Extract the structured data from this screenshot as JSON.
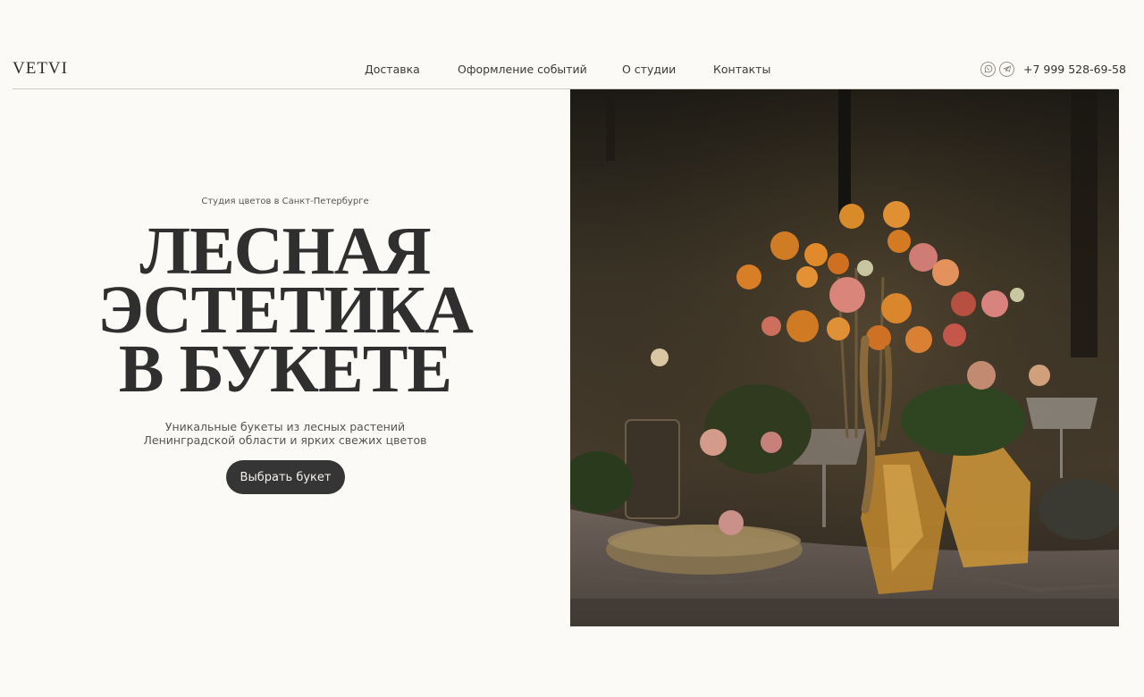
{
  "header": {
    "logo": "VETVI",
    "nav": [
      "Доставка",
      "Оформление событий",
      "О студии",
      "Контакты"
    ],
    "phone": "+7 999 528-69-58",
    "icons": [
      "whatsapp-icon",
      "telegram-icon"
    ]
  },
  "hero": {
    "subtitle": "Студия цветов в Санкт-Петербурге",
    "headline": [
      "ЛЕСНАЯ",
      "ЭСТЕТИКА",
      "В БУКЕТЕ"
    ],
    "description": [
      "Уникальные букеты из лесных растений",
      "Ленинградской области и ярких свежих цветов"
    ],
    "cta_label": "Выбрать букет"
  },
  "colors": {
    "background": "#fcfaf7",
    "text": "#2f2f2f",
    "button": "#353535"
  }
}
